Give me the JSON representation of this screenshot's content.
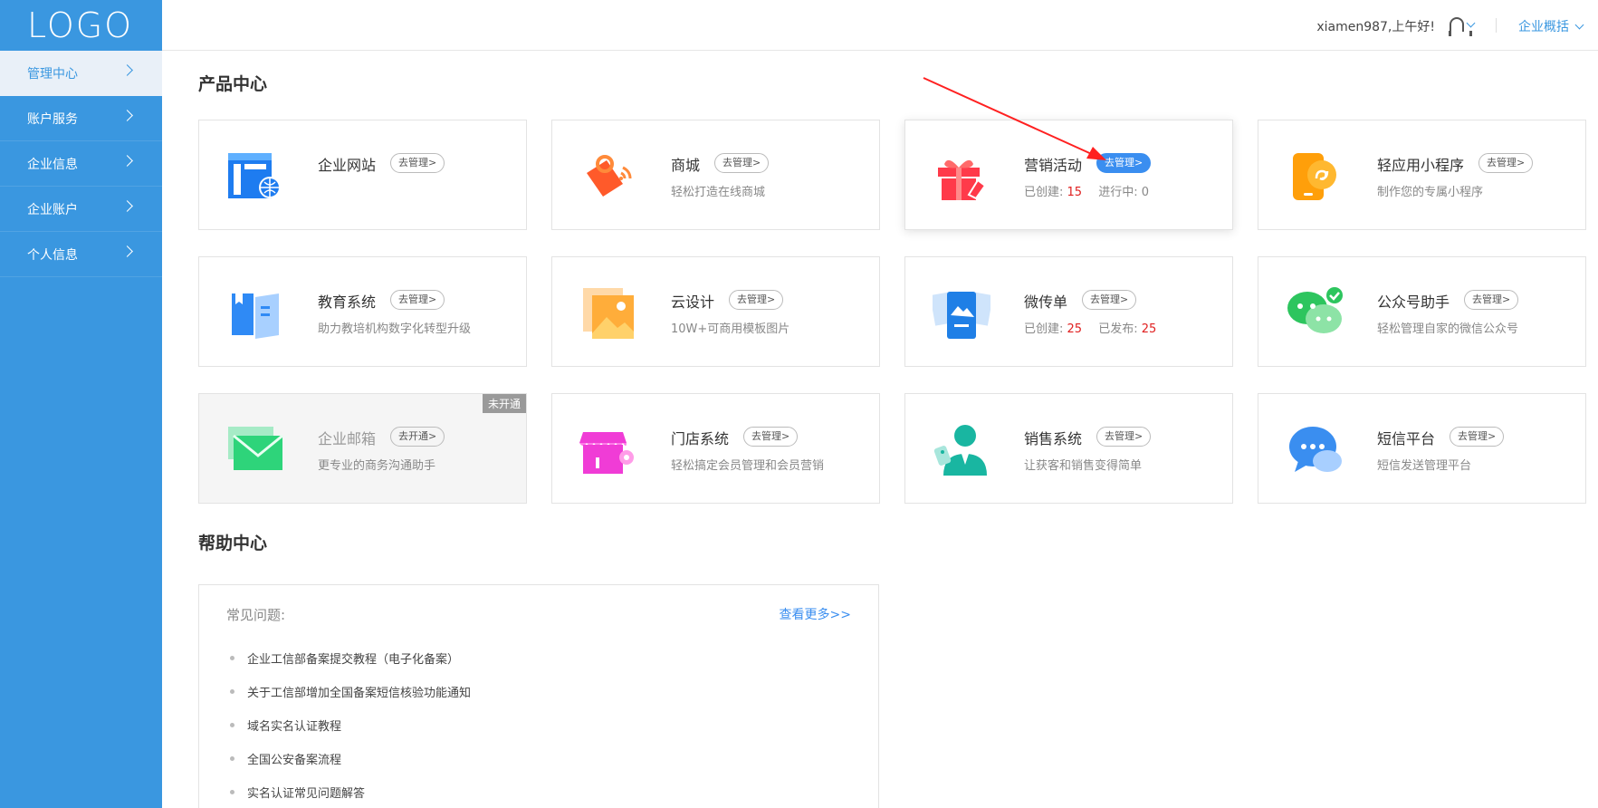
{
  "logo": "LOGO",
  "sidebar": {
    "items": [
      {
        "label": "管理中心",
        "active": true
      },
      {
        "label": "账户服务"
      },
      {
        "label": "企业信息"
      },
      {
        "label": "企业账户"
      },
      {
        "label": "个人信息"
      }
    ]
  },
  "topbar": {
    "greeting": "xiamen987,上午好!",
    "overview": "企业概括"
  },
  "products": {
    "title": "产品中心",
    "cards": [
      {
        "name": "企业网站",
        "action": "去管理>",
        "desc": ""
      },
      {
        "name": "商城",
        "action": "去管理>",
        "desc": "轻松打造在线商城"
      },
      {
        "name": "营销活动",
        "action": "去管理>",
        "stat1_label": "已创建:",
        "stat1_value": "15",
        "stat2_label": "进行中:",
        "stat2_value": "0"
      },
      {
        "name": "轻应用小程序",
        "action": "去管理>",
        "desc": "制作您的专属小程序"
      },
      {
        "name": "教育系统",
        "action": "去管理>",
        "desc": "助力教培机构数字化转型升级"
      },
      {
        "name": "云设计",
        "action": "去管理>",
        "desc": "10W+可商用模板图片"
      },
      {
        "name": "微传单",
        "action": "去管理>",
        "stat1_label": "已创建:",
        "stat1_value": "25",
        "stat2_label": "已发布:",
        "stat2_value": "25"
      },
      {
        "name": "公众号助手",
        "action": "去管理>",
        "desc": "轻松管理自家的微信公众号"
      },
      {
        "name": "企业邮箱",
        "action": "去开通>",
        "desc": "更专业的商务沟通助手",
        "badge": "未开通"
      },
      {
        "name": "门店系统",
        "action": "去管理>",
        "desc": "轻松搞定会员管理和会员营销"
      },
      {
        "name": "销售系统",
        "action": "去管理>",
        "desc": "让获客和销售变得简单"
      },
      {
        "name": "短信平台",
        "action": "去管理>",
        "desc": "短信发送管理平台"
      }
    ]
  },
  "help": {
    "title": "帮助中心",
    "faq_label": "常见问题:",
    "more": "查看更多>>",
    "items": [
      "企业工信部备案提交教程（电子化备案）",
      "关于工信部增加全国备案短信核验功能通知",
      "域名实名认证教程",
      "全国公安备案流程",
      "实名认证常见问题解答"
    ]
  },
  "colors": {
    "sidebar": "#3a97e0",
    "accent": "#3a8ef0",
    "stat_number": "#e02020"
  }
}
